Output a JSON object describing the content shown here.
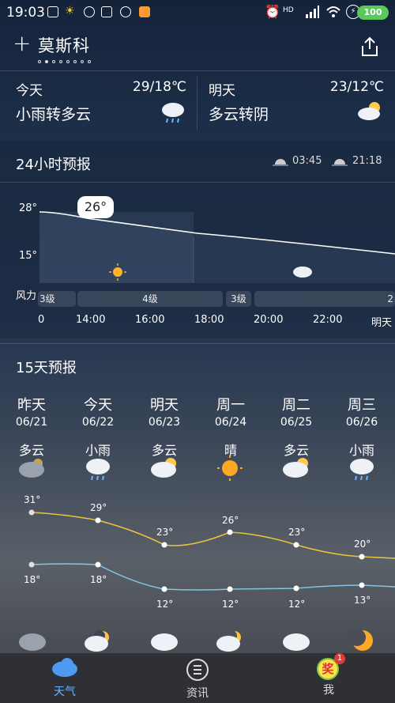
{
  "status": {
    "time": "19:03",
    "battery": "100"
  },
  "header": {
    "city": "莫斯科",
    "add_icon": "plus-icon",
    "share_icon": "share-icon"
  },
  "today": {
    "label": "今天",
    "temp": "29/18℃",
    "cond": "小雨转多云",
    "icon": "rain-cloud-icon"
  },
  "tomorrow": {
    "label": "明天",
    "temp": "23/12℃",
    "cond": "多云转阴",
    "icon": "partly-cloudy-icon"
  },
  "hourly": {
    "title": "24小时预报",
    "sunrise": "03:45",
    "sunset": "21:18",
    "y_labels": [
      "28°",
      "15°"
    ],
    "current_temp": "26°",
    "wind_label": "风力",
    "wind": [
      "3级",
      "4级",
      "3级",
      "2"
    ],
    "times": [
      "0",
      "14:00",
      "16:00",
      "18:00",
      "20:00",
      "22:00",
      "明天"
    ]
  },
  "daily": {
    "title": "15天预报",
    "days": [
      {
        "week": "昨天",
        "date": "06/21",
        "cond": "多云",
        "high": "31°",
        "low": "18°"
      },
      {
        "week": "今天",
        "date": "06/22",
        "cond": "小雨",
        "high": "29°",
        "low": "18°"
      },
      {
        "week": "明天",
        "date": "06/23",
        "cond": "多云",
        "high": "23°",
        "low": "12°"
      },
      {
        "week": "周一",
        "date": "06/24",
        "cond": "晴",
        "high": "26°",
        "low": "12°"
      },
      {
        "week": "周二",
        "date": "06/25",
        "cond": "多云",
        "high": "23°",
        "low": "12°"
      },
      {
        "week": "周三",
        "date": "06/26",
        "cond": "小雨",
        "high": "20°",
        "low": "13°"
      }
    ]
  },
  "nav": [
    {
      "label": "天气",
      "icon": "cloud-icon",
      "active": true
    },
    {
      "label": "资讯",
      "icon": "news-icon",
      "active": false
    },
    {
      "label": "我",
      "icon": "profile-badge-icon",
      "badge": "1",
      "badge_text": "奖",
      "active": false
    }
  ]
}
